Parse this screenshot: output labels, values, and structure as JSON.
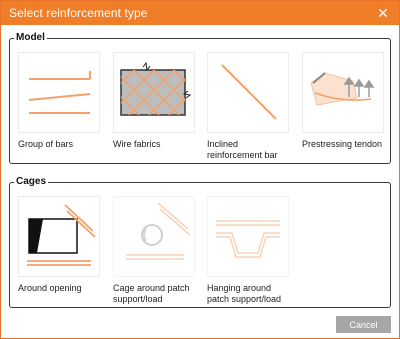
{
  "window": {
    "title": "Select reinforcement type",
    "close_glyph": "✕"
  },
  "groups": [
    {
      "legend": "Model",
      "items": [
        {
          "label": "Group of bars",
          "icon": "group-of-bars-icon"
        },
        {
          "label": "Wire fabrics",
          "icon": "wire-fabrics-icon"
        },
        {
          "label": "Inclined reinforcement bar",
          "icon": "inclined-bar-icon"
        },
        {
          "label": "Prestressing tendon",
          "icon": "prestressing-tendon-icon"
        }
      ]
    },
    {
      "legend": "Cages",
      "items": [
        {
          "label": "Around opening",
          "icon": "around-opening-icon"
        },
        {
          "label": "Cage around patch support/load",
          "icon": "cage-around-patch-icon"
        },
        {
          "label": "Hanging around patch support/load",
          "icon": "hanging-around-patch-icon"
        }
      ]
    }
  ],
  "footer": {
    "cancel_label": "Cancel"
  },
  "colors": {
    "accent": "#f07d28",
    "bar": "#f4a06a",
    "cancel_bg": "#a6a6a6"
  }
}
